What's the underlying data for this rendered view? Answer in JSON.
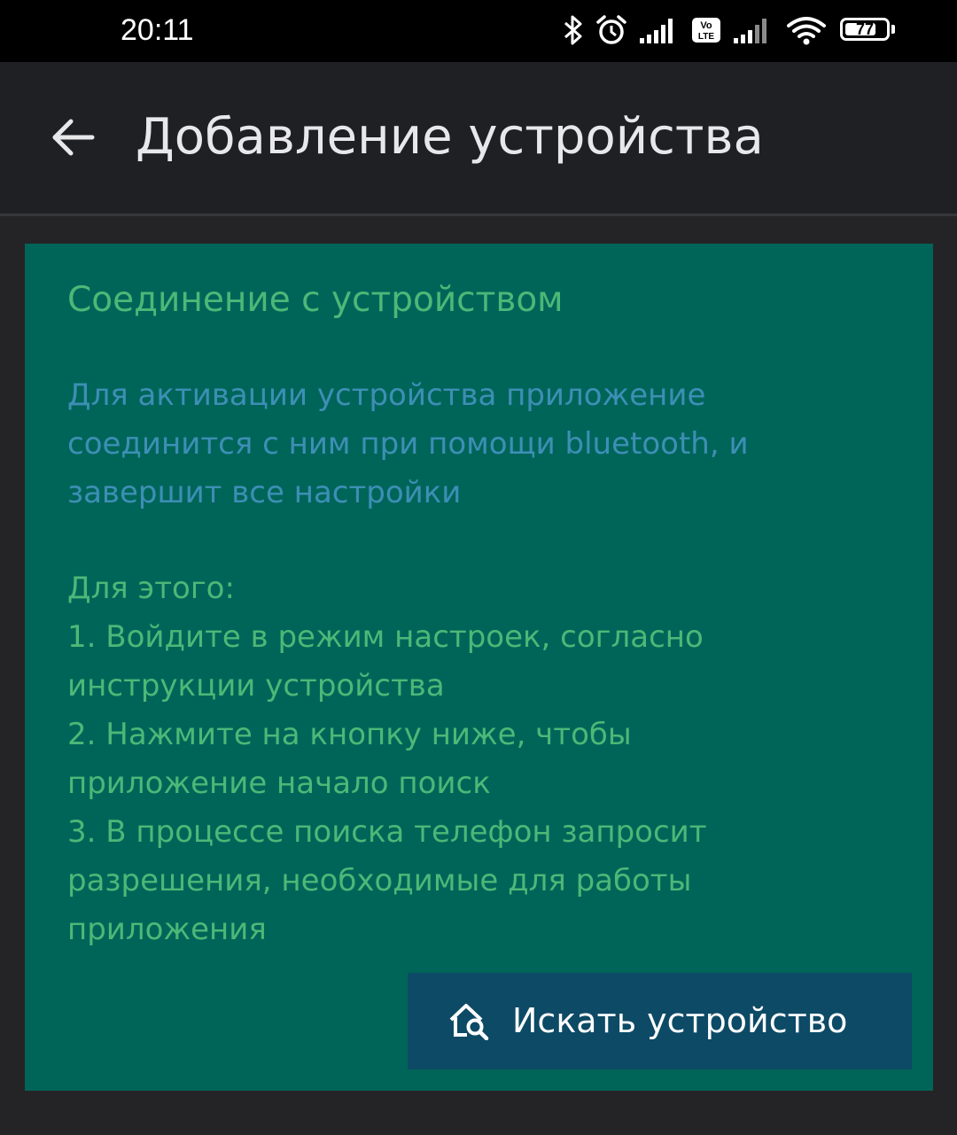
{
  "status_bar": {
    "time": "20:11",
    "battery_percent": 77,
    "battery_label": "77",
    "icons": [
      "bluetooth-icon",
      "alarm-icon",
      "signal-icon",
      "volte-icon",
      "signal-icon",
      "wifi-icon",
      "battery-icon"
    ]
  },
  "app_bar": {
    "back_icon": "arrow-left-icon",
    "title": "Добавление устройства"
  },
  "card": {
    "title": "Соединение с устройством",
    "description": "Для активации устройства приложение\nсоединится с ним при помощи bluetooth, и\nзавершит все настройки",
    "instructions": "Для этого:\n1. Войдите в режим настроек, согласно\nинструкции устройства\n2. Нажмите на кнопку ниже, чтобы\nприложение начало поиск\n3. В процессе поиска телефон запросит\nразрешения, необходимые для работы\nприложения",
    "button": {
      "icon": "home-search-icon",
      "label": "Искать устройство"
    }
  },
  "colors": {
    "status_bar_bg": "#000000",
    "app_bar_bg": "#1f2024",
    "page_bg": "#242427",
    "card_bg": "#006559",
    "title_green": "#4db877",
    "description_blue": "#3d8fb5",
    "button_bg": "#0d4a66",
    "button_text": "#ffffff"
  }
}
